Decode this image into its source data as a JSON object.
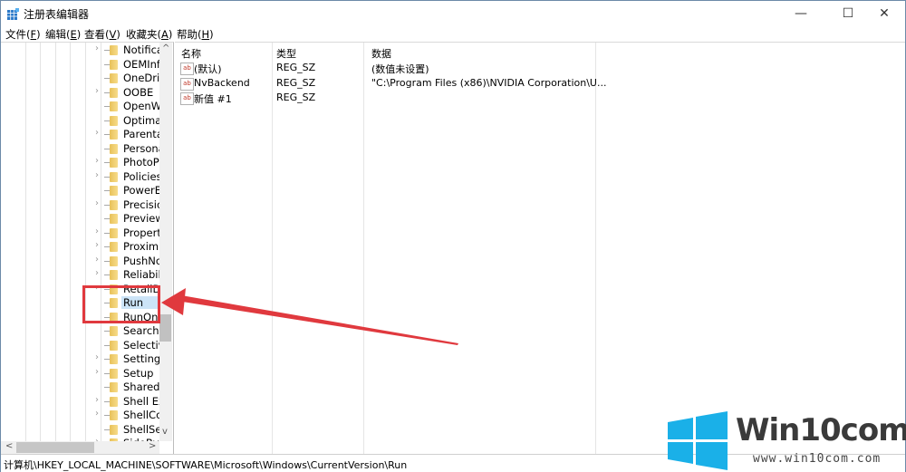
{
  "window": {
    "title": "注册表编辑器",
    "controls": {
      "minimize": "—",
      "maximize": "☐",
      "close": "✕"
    }
  },
  "menu": [
    {
      "label": "文件(",
      "key": "F",
      "end": ")"
    },
    {
      "label": "编辑(",
      "key": "E",
      "end": ")"
    },
    {
      "label": "查看(",
      "key": "V",
      "end": ")"
    },
    {
      "label": "收藏夹(",
      "key": "A",
      "end": ")"
    },
    {
      "label": "帮助(",
      "key": "H",
      "end": ")"
    }
  ],
  "tree": {
    "items": [
      {
        "label": "Notifica",
        "expandable": true
      },
      {
        "label": "OEMInfo",
        "expandable": false
      },
      {
        "label": "OneDriv",
        "expandable": false
      },
      {
        "label": "OOBE",
        "expandable": true
      },
      {
        "label": "OpenW",
        "expandable": false
      },
      {
        "label": "Optimal",
        "expandable": false
      },
      {
        "label": "Parenta",
        "expandable": true
      },
      {
        "label": "Persona",
        "expandable": false
      },
      {
        "label": "PhotoPr",
        "expandable": true
      },
      {
        "label": "Policies",
        "expandable": true
      },
      {
        "label": "PowerE",
        "expandable": false
      },
      {
        "label": "Precisio",
        "expandable": true
      },
      {
        "label": "Preview",
        "expandable": false
      },
      {
        "label": "Propert",
        "expandable": true
      },
      {
        "label": "Proximi",
        "expandable": true
      },
      {
        "label": "PushNo",
        "expandable": true
      },
      {
        "label": "Reliabili",
        "expandable": true
      },
      {
        "label": "RetailD",
        "expandable": true
      },
      {
        "label": "Run",
        "expandable": false,
        "selected": true
      },
      {
        "label": "RunOnce",
        "expandable": false
      },
      {
        "label": "Search",
        "expandable": false
      },
      {
        "label": "Selectiv",
        "expandable": false
      },
      {
        "label": "Setting",
        "expandable": true
      },
      {
        "label": "Setup",
        "expandable": true
      },
      {
        "label": "SharedD",
        "expandable": false
      },
      {
        "label": "Shell Ex",
        "expandable": true
      },
      {
        "label": "ShellCo",
        "expandable": true
      },
      {
        "label": "ShellSer",
        "expandable": false
      },
      {
        "label": "SideBy",
        "expandable": true
      }
    ],
    "scroll_up": "^",
    "scroll_down": "v",
    "scroll_left": "<",
    "scroll_right": ">"
  },
  "values": {
    "headers": {
      "name": "名称",
      "type": "类型",
      "data": "数据"
    },
    "rows": [
      {
        "icon": "ab",
        "name": "(默认)",
        "type": "REG_SZ",
        "data": "(数值未设置)"
      },
      {
        "icon": "ab",
        "name": "NvBackend",
        "type": "REG_SZ",
        "data": "\"C:\\Program Files (x86)\\NVIDIA Corporation\\U..."
      },
      {
        "icon": "ab",
        "name": "新值 #1",
        "type": "REG_SZ",
        "data": ""
      }
    ]
  },
  "status": {
    "path": "计算机\\HKEY_LOCAL_MACHINE\\SOFTWARE\\Microsoft\\Windows\\CurrentVersion\\Run"
  },
  "annotation": {
    "color": "#e0393e"
  },
  "watermark": {
    "title": "Win10com",
    "url": "www.win10com.com",
    "logo_color": "#1ab0e8"
  }
}
